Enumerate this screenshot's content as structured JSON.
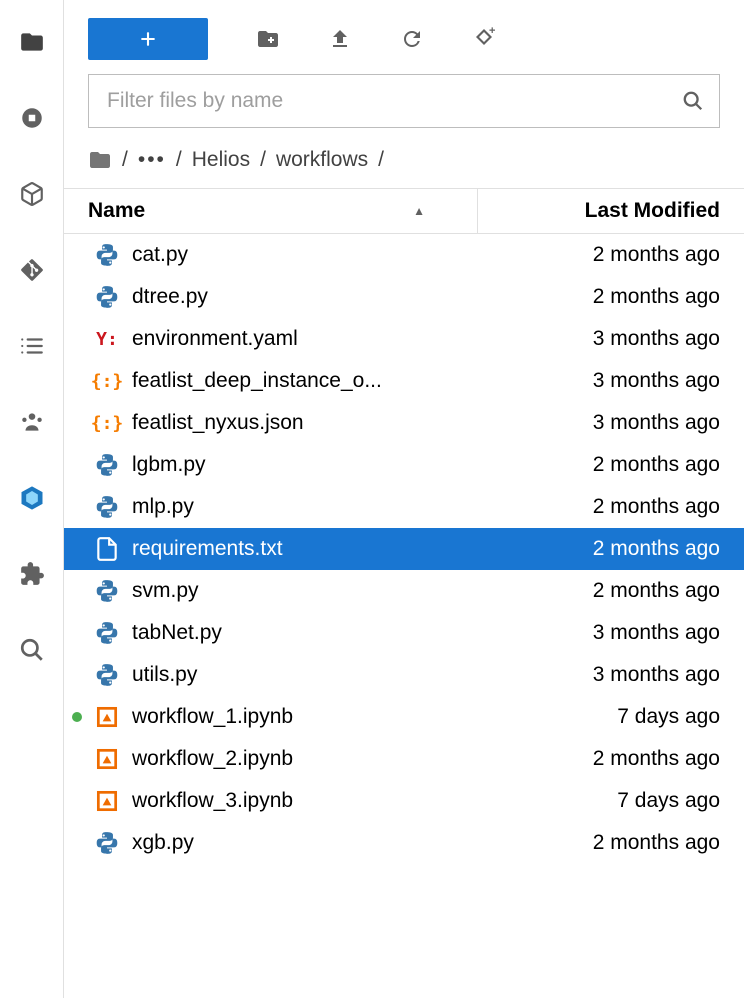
{
  "toolbar": {
    "new_label": "+",
    "filter_placeholder": "Filter files by name"
  },
  "breadcrumb": {
    "items": [
      "Helios",
      "workflows"
    ]
  },
  "columns": {
    "name": "Name",
    "modified": "Last Modified"
  },
  "files": [
    {
      "name": "cat.py",
      "modified": "2 months ago",
      "icon": "python",
      "selected": false,
      "running": false
    },
    {
      "name": "dtree.py",
      "modified": "2 months ago",
      "icon": "python",
      "selected": false,
      "running": false
    },
    {
      "name": "environment.yaml",
      "modified": "3 months ago",
      "icon": "yaml",
      "selected": false,
      "running": false
    },
    {
      "name": "featlist_deep_instance_o...",
      "modified": "3 months ago",
      "icon": "json",
      "selected": false,
      "running": false
    },
    {
      "name": "featlist_nyxus.json",
      "modified": "3 months ago",
      "icon": "json",
      "selected": false,
      "running": false
    },
    {
      "name": "lgbm.py",
      "modified": "2 months ago",
      "icon": "python",
      "selected": false,
      "running": false
    },
    {
      "name": "mlp.py",
      "modified": "2 months ago",
      "icon": "python",
      "selected": false,
      "running": false
    },
    {
      "name": "requirements.txt",
      "modified": "2 months ago",
      "icon": "text",
      "selected": true,
      "running": false
    },
    {
      "name": "svm.py",
      "modified": "2 months ago",
      "icon": "python",
      "selected": false,
      "running": false
    },
    {
      "name": "tabNet.py",
      "modified": "3 months ago",
      "icon": "python",
      "selected": false,
      "running": false
    },
    {
      "name": "utils.py",
      "modified": "3 months ago",
      "icon": "python",
      "selected": false,
      "running": false
    },
    {
      "name": "workflow_1.ipynb",
      "modified": "7 days ago",
      "icon": "notebook",
      "selected": false,
      "running": true
    },
    {
      "name": "workflow_2.ipynb",
      "modified": "2 months ago",
      "icon": "notebook",
      "selected": false,
      "running": false
    },
    {
      "name": "workflow_3.ipynb",
      "modified": "7 days ago",
      "icon": "notebook",
      "selected": false,
      "running": false
    },
    {
      "name": "xgb.py",
      "modified": "2 months ago",
      "icon": "python",
      "selected": false,
      "running": false
    }
  ]
}
